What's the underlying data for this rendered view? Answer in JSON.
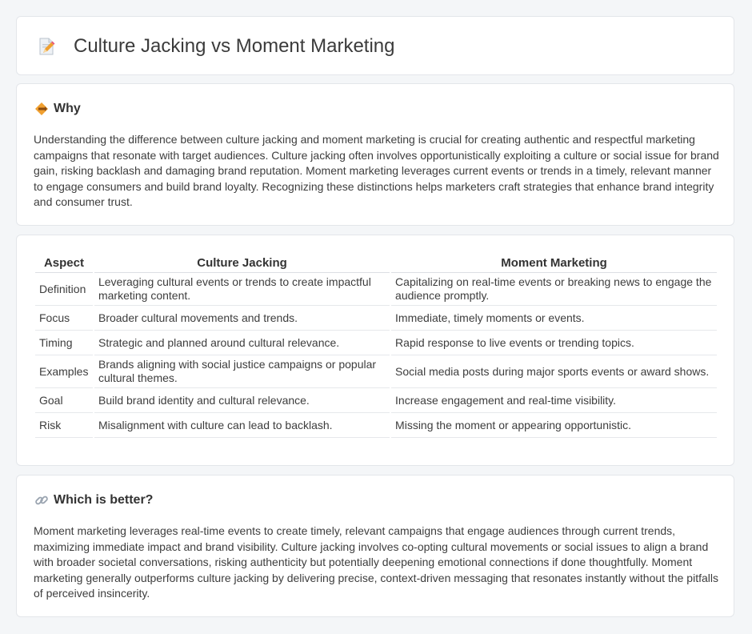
{
  "header": {
    "title": "Culture Jacking vs Moment Marketing",
    "icon": "document-edit-icon"
  },
  "why": {
    "heading": "Why",
    "icon": "diamond-sign-icon",
    "text": "Understanding the difference between culture jacking and moment marketing is crucial for creating authentic and respectful marketing campaigns that resonate with target audiences. Culture jacking often involves opportunistically exploiting a culture or social issue for brand gain, risking backlash and damaging brand reputation. Moment marketing leverages current events or trends in a timely, relevant manner to engage consumers and build brand loyalty. Recognizing these distinctions helps marketers craft strategies that enhance brand integrity and consumer trust."
  },
  "table": {
    "headers": [
      "Aspect",
      "Culture Jacking",
      "Moment Marketing"
    ],
    "rows": [
      [
        "Definition",
        "Leveraging cultural events or trends to create impactful marketing content.",
        "Capitalizing on real-time events or breaking news to engage the audience promptly."
      ],
      [
        "Focus",
        "Broader cultural movements and trends.",
        "Immediate, timely moments or events."
      ],
      [
        "Timing",
        "Strategic and planned around cultural relevance.",
        "Rapid response to live events or trending topics."
      ],
      [
        "Examples",
        "Brands aligning with social justice campaigns or popular cultural themes.",
        "Social media posts during major sports events or award shows."
      ],
      [
        "Goal",
        "Build brand identity and cultural relevance.",
        "Increase engagement and real-time visibility."
      ],
      [
        "Risk",
        "Misalignment with culture can lead to backlash.",
        "Missing the moment or appearing opportunistic."
      ]
    ]
  },
  "better": {
    "heading": "Which is better?",
    "icon": "link-icon",
    "text": "Moment marketing leverages real-time events to create timely, relevant campaigns that engage audiences through current trends, maximizing immediate impact and brand visibility. Culture jacking involves co-opting cultural movements or social issues to align a brand with broader societal conversations, risking authenticity but potentially deepening emotional connections if done thoughtfully. Moment marketing generally outperforms culture jacking by delivering precise, context-driven messaging that resonates instantly without the pitfalls of perceived insincerity."
  },
  "colors": {
    "background": "#f4f6f8",
    "card": "#ffffff",
    "icon_orange": "#f0a030",
    "icon_pink": "#e85a7a"
  }
}
